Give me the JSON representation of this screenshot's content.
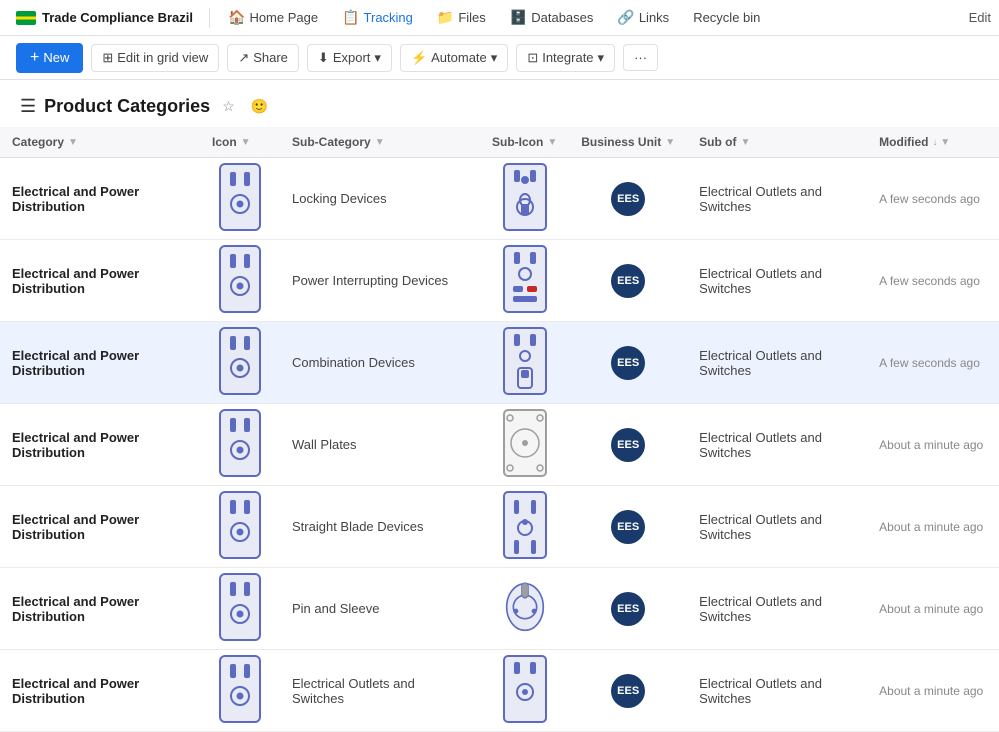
{
  "app": {
    "title": "Trade Compliance Brazil",
    "nav": [
      {
        "label": "Home Page",
        "icon": "🏠",
        "active": false
      },
      {
        "label": "Tracking",
        "icon": "📋",
        "active": true
      },
      {
        "label": "Files",
        "icon": "📁",
        "active": false
      },
      {
        "label": "Databases",
        "icon": "🗄️",
        "active": false
      },
      {
        "label": "Links",
        "icon": "🔗",
        "active": false
      },
      {
        "label": "Recycle bin",
        "icon": "",
        "active": false
      }
    ],
    "edit_label": "Edit"
  },
  "toolbar": {
    "new_label": "New",
    "edit_grid_label": "Edit in grid view",
    "share_label": "Share",
    "export_label": "Export",
    "automate_label": "Automate",
    "integrate_label": "Integrate",
    "more_label": "···"
  },
  "page": {
    "title": "Product Categories",
    "icon": "☰"
  },
  "table": {
    "columns": [
      {
        "label": "Category",
        "sort": "▼"
      },
      {
        "label": "Icon",
        "sort": "▼"
      },
      {
        "label": "Sub-Category",
        "sort": "▼"
      },
      {
        "label": "Sub-Icon",
        "sort": "▼"
      },
      {
        "label": "Business Unit",
        "sort": "▼"
      },
      {
        "label": "Sub of",
        "sort": "▼"
      },
      {
        "label": "Modified",
        "sort": "↓ ▼"
      }
    ],
    "rows": [
      {
        "id": 1,
        "category": "Electrical and Power Distribution",
        "subcategory": "Locking Devices",
        "business_unit": "EES",
        "sub_of": "Electrical Outlets and Switches",
        "modified": "A few seconds ago",
        "selected": false
      },
      {
        "id": 2,
        "category": "Electrical and Power Distribution",
        "subcategory": "Power Interrupting Devices",
        "business_unit": "EES",
        "sub_of": "Electrical Outlets and Switches",
        "modified": "A few seconds ago",
        "selected": false
      },
      {
        "id": 3,
        "category": "Electrical and Power Distribution",
        "subcategory": "Combination Devices",
        "business_unit": "EES",
        "sub_of": "Electrical Outlets and Switches",
        "modified": "A few seconds ago",
        "selected": true
      },
      {
        "id": 4,
        "category": "Electrical and Power Distribution",
        "subcategory": "Wall Plates",
        "business_unit": "EES",
        "sub_of": "Electrical Outlets and Switches",
        "modified": "About a minute ago",
        "selected": false
      },
      {
        "id": 5,
        "category": "Electrical and Power Distribution",
        "subcategory": "Straight Blade Devices",
        "business_unit": "EES",
        "sub_of": "Electrical Outlets and Switches",
        "modified": "About a minute ago",
        "selected": false
      },
      {
        "id": 6,
        "category": "Electrical and Power Distribution",
        "subcategory": "Pin and Sleeve",
        "business_unit": "EES",
        "sub_of": "Electrical Outlets and Switches",
        "modified": "About a minute ago",
        "selected": false
      },
      {
        "id": 7,
        "category": "Electrical and Power Distribution",
        "subcategory": "Electrical Outlets and Switches",
        "business_unit": "EES",
        "sub_of": "Electrical Outlets and Switches",
        "modified": "About a minute ago",
        "selected": false
      }
    ]
  }
}
